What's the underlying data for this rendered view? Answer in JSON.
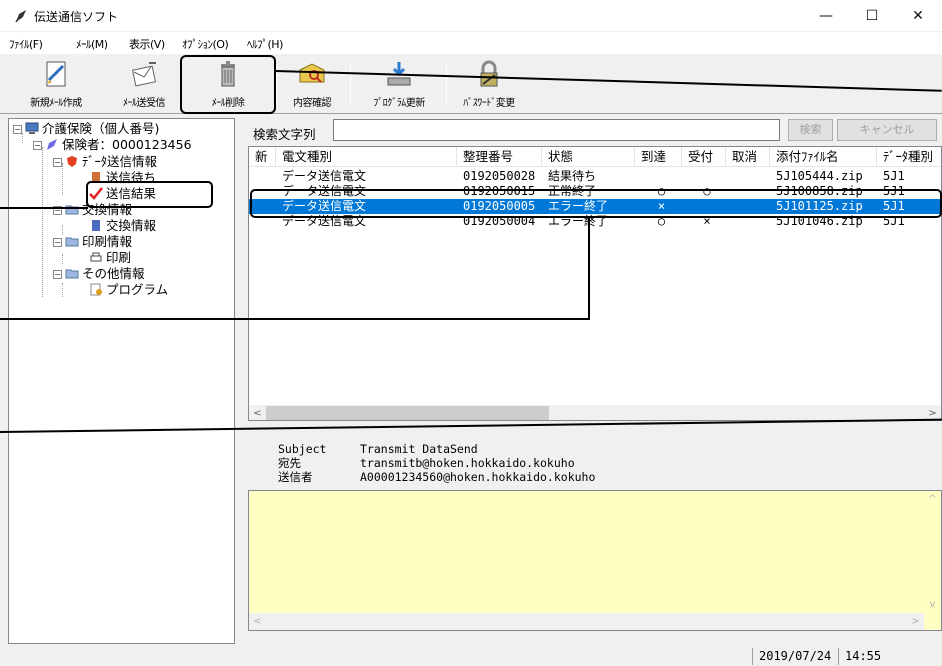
{
  "window": {
    "title": "伝送通信ソフト",
    "minimize": "—",
    "maximize": "☐",
    "close": "✕"
  },
  "menu": [
    "ﾌｧｲﾙ(F)",
    "ﾒｰﾙ(M)",
    "表示(V)",
    "ｵﾌﾟｼｮﾝ(O)",
    "ﾍﾙﾌﾟ(H)"
  ],
  "toolbar": {
    "new_mail": "新規ﾒｰﾙ作成",
    "send_receive": "ﾒｰﾙ送受信",
    "delete_mail": "ﾒｰﾙ削除",
    "confirm": "内容確認",
    "update": "ﾌﾟﾛｸﾞﾗﾑ更新",
    "password": "ﾊﾟｽﾜｰﾄﾞ変更"
  },
  "tree": {
    "root": "介護保険（個人番号)",
    "insurer": "保険者：0000123456",
    "data_send": "ﾃﾞｰﾀ送信情報",
    "waiting": "送信待ち",
    "result": "送信結果",
    "exchange": "交換情報",
    "exchange_child": "交換情報",
    "print": "印刷情報",
    "print_child": "印刷",
    "other": "その他情報",
    "program": "プログラム"
  },
  "search": {
    "label": "検索文字列",
    "value": "",
    "search_btn": "検索",
    "cancel_btn": "キャンセル"
  },
  "list": {
    "columns": [
      "新",
      "電文種別",
      "整理番号",
      "状態",
      "到達",
      "受付",
      "取消",
      "添付ﾌｧｲﾙ名",
      "ﾃﾞｰﾀ種別"
    ],
    "rows": [
      {
        "new": "",
        "type": "データ送信電文",
        "no": "0192050028",
        "status": "結果待ち",
        "arrive": "",
        "accept": "",
        "cancel": "",
        "file": "5J105444.zip",
        "kind": "5J1"
      },
      {
        "new": "",
        "type": "データ送信電文",
        "no": "0192050015",
        "status": "正常終了",
        "arrive": "○",
        "accept": "○",
        "cancel": "",
        "file": "5J100858.zip",
        "kind": "5J1"
      },
      {
        "new": "",
        "type": "データ送信電文",
        "no": "0192050005",
        "status": "エラー終了",
        "arrive": "×",
        "accept": "",
        "cancel": "",
        "file": "5J101125.zip",
        "kind": "5J1"
      },
      {
        "new": "",
        "type": "データ送信電文",
        "no": "0192050004",
        "status": "エラー終了",
        "arrive": "○",
        "accept": "×",
        "cancel": "",
        "file": "5J101046.zip",
        "kind": "5J1"
      }
    ]
  },
  "detail": {
    "subject_label": "Subject",
    "subject": "Transmit DataSend",
    "to_label": "宛先",
    "to": "transmitb@hoken.hokkaido.kokuho",
    "from_label": "送信者",
    "from": "A00001234560@hoken.hokkaido.kokuho"
  },
  "status": {
    "date": "2019/07/24",
    "time": "14:55"
  },
  "colors": {
    "selection": "#0078d7",
    "body_bg": "#ffffc4"
  }
}
